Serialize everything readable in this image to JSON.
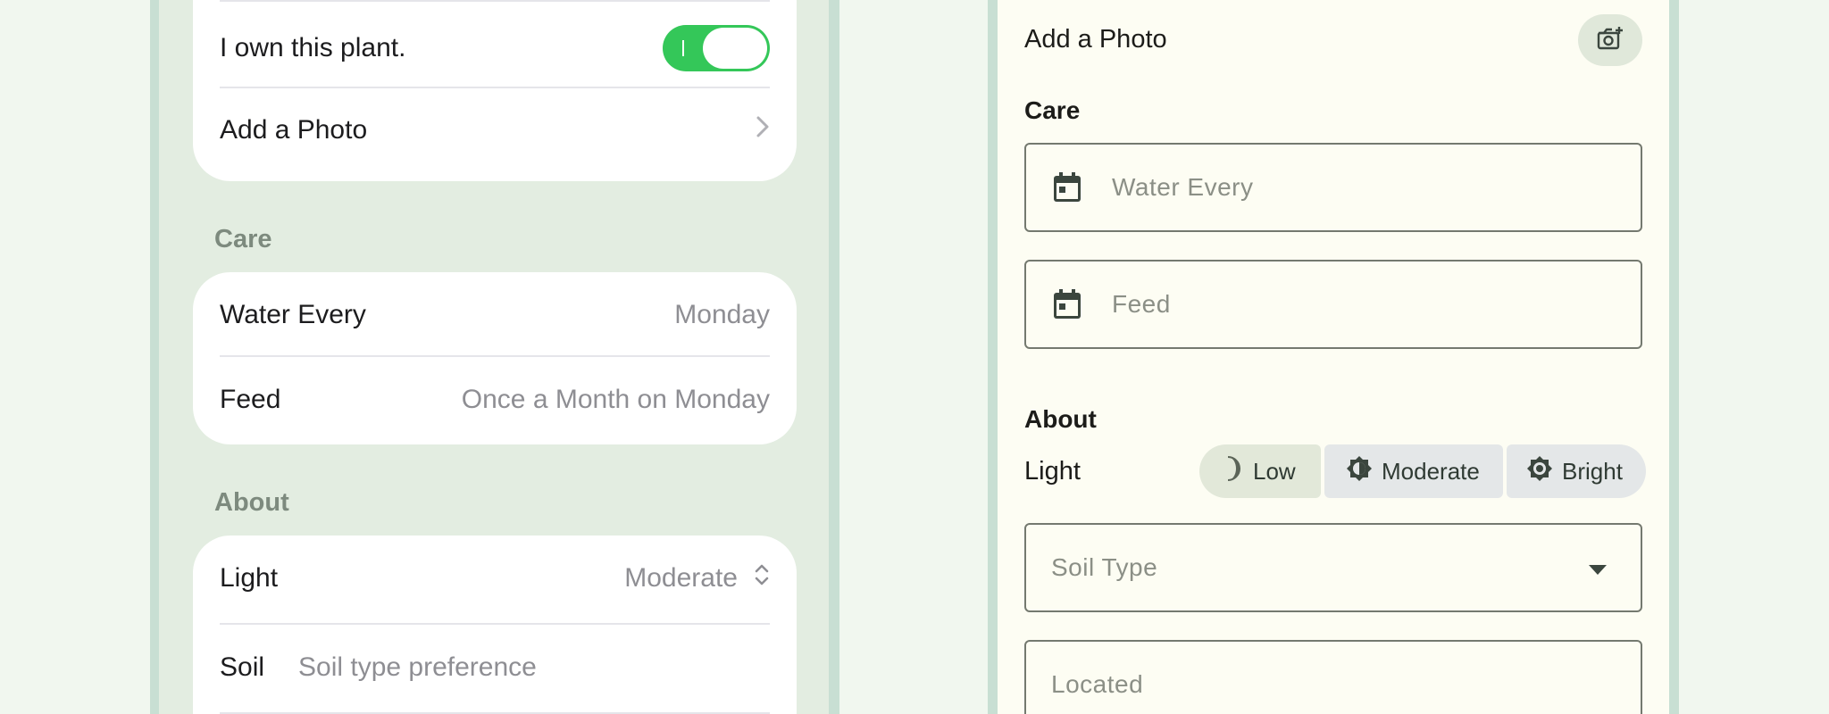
{
  "ios": {
    "own_label": "I own this plant.",
    "add_photo_label": "Add a Photo",
    "care_header": "Care",
    "water_label": "Water Every",
    "water_value": "Monday",
    "feed_label": "Feed",
    "feed_value": "Once a Month on Monday",
    "about_header": "About",
    "light_label": "Light",
    "light_value": "Moderate",
    "soil_label": "Soil",
    "soil_placeholder": "Soil type preference",
    "own_toggle_on": true
  },
  "material": {
    "add_photo_label": "Add a Photo",
    "care_header": "Care",
    "water_placeholder": "Water Every",
    "feed_placeholder": "Feed",
    "about_header": "About",
    "light_label": "Light",
    "light_options": [
      "Low",
      "Moderate",
      "Bright"
    ],
    "light_selected": "Low",
    "soil_placeholder": "Soil Type",
    "located_placeholder": "Located"
  },
  "colors": {
    "ios_toggle": "#34c759",
    "background": "#f1f7ef",
    "frame": "#c8dfd3"
  }
}
